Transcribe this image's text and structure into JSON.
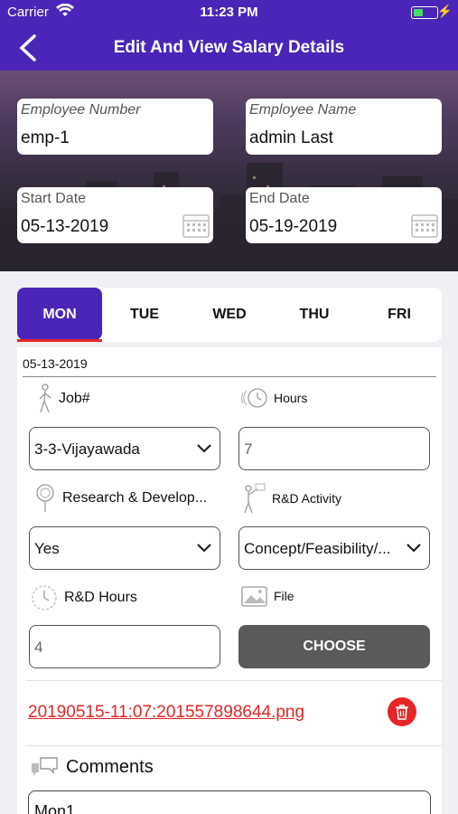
{
  "status": {
    "carrier": "Carrier",
    "time": "11:23 PM"
  },
  "nav": {
    "title": "Edit And View Salary Details"
  },
  "employee": {
    "number_label": "Employee Number",
    "number_value": "emp-1",
    "name_label": "Employee Name",
    "name_value": "admin Last",
    "start_label": "Start Date",
    "start_value": "05-13-2019",
    "end_label": "End Date",
    "end_value": "05-19-2019"
  },
  "days": [
    {
      "label": "MON",
      "active": true
    },
    {
      "label": "TUE",
      "active": false
    },
    {
      "label": "WED",
      "active": false
    },
    {
      "label": "THU",
      "active": false
    },
    {
      "label": "FRI",
      "active": false
    }
  ],
  "form": {
    "date": "05-13-2019",
    "job_label": "Job#",
    "job_value": "3-3-Vijayawada",
    "hours_label": "Hours",
    "hours_value": "7",
    "research_label": "Research & Develop...",
    "research_value": "Yes",
    "rd_activity_label": "R&D Activity",
    "rd_activity_value": "Concept/Feasibility/...",
    "rd_hours_label": "R&D Hours",
    "rd_hours_value": "4",
    "file_label": "File",
    "choose_label": "CHOOSE",
    "file_link": "20190515-11:07:201557898644.png",
    "comments_label": "Comments",
    "comments_value": "Mon1"
  },
  "colors": {
    "primary": "#4a25b8",
    "danger": "#e52626",
    "button_grey": "#5a5a5a"
  }
}
